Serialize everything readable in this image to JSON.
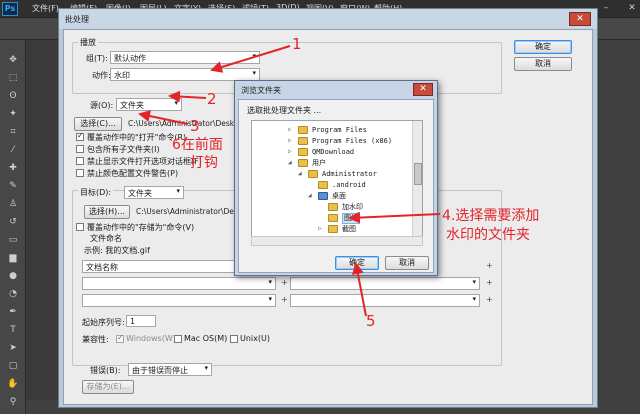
{
  "app": {
    "logo": "Ps",
    "menu": [
      "文件(F)",
      "编辑(E)",
      "图像(I)",
      "图层(L)",
      "文字(Y)",
      "选择(S)",
      "滤镜(T)",
      "3D(D)",
      "视图(V)",
      "窗口(W)",
      "帮助(H)"
    ]
  },
  "dialog": {
    "title": "批处理",
    "ok": "确定",
    "cancel": "取消",
    "close": "✕",
    "play": {
      "group": "播放",
      "set_label": "组(T):",
      "set_value": "默认动作",
      "action_label": "动作:",
      "action_value": "水印"
    },
    "source": {
      "label": "源(O):",
      "value": "文件夹",
      "choose": "选择(C)...",
      "path": "C:\\Users\\Administrator\\Deskt",
      "checks": [
        {
          "label": "覆盖动作中的\"打开\"命令(R)",
          "checked": true
        },
        {
          "label": "包含所有子文件夹(I)",
          "checked": false
        },
        {
          "label": "禁止显示文件打开选项对话框(F)",
          "checked": false
        },
        {
          "label": "禁止颜色配置文件警告(P)",
          "checked": false
        }
      ]
    },
    "dest": {
      "label": "目标(D):",
      "value": "文件夹",
      "choose": "选择(H)...",
      "path": "C:\\Users\\Administrator\\Deskt",
      "override": "覆盖动作中的\"存储为\"命令(V)",
      "naming": "文件命名",
      "example": "示例: 我的文档.gif",
      "name_field": "文档名称",
      "serial_label": "起始序列号:",
      "serial_value": "1",
      "compat": "兼容性:",
      "windows": "Windows(W)",
      "macos": "Mac OS(M)",
      "unix": "Unix(U)"
    },
    "errors": {
      "label": "错误(B):",
      "value": "由于错误而停止",
      "save_as": "存储为(E)..."
    }
  },
  "browse": {
    "title": "浏览文件夹",
    "prompt": "选取批处理文件夹 ...",
    "close": "✕",
    "tree": [
      {
        "name": "Program Files",
        "tri": "▷"
      },
      {
        "name": "Program Files (x86)",
        "tri": "▷"
      },
      {
        "name": "QMDownload",
        "tri": "▷"
      },
      {
        "name": "用户",
        "tri": "◢"
      },
      {
        "name": "Administrator",
        "tri": "◢"
      },
      {
        "name": ".android",
        "tri": ""
      },
      {
        "name": "桌面",
        "tri": "◢"
      },
      {
        "name": "加水印",
        "tri": ""
      },
      {
        "name": "图片",
        "tri": ""
      },
      {
        "name": "截图",
        "tri": "▷"
      }
    ],
    "ok": "确定",
    "cancel": "取消"
  },
  "annotations": {
    "n1": "1",
    "n2": "2",
    "n3": "3",
    "n5": "5",
    "note6a": "6在前面",
    "note6b": "打钩",
    "note4a": "4.选择需要添加",
    "note4b": "水印的文件夹"
  },
  "colors": {
    "annotation": "#e3242b"
  }
}
